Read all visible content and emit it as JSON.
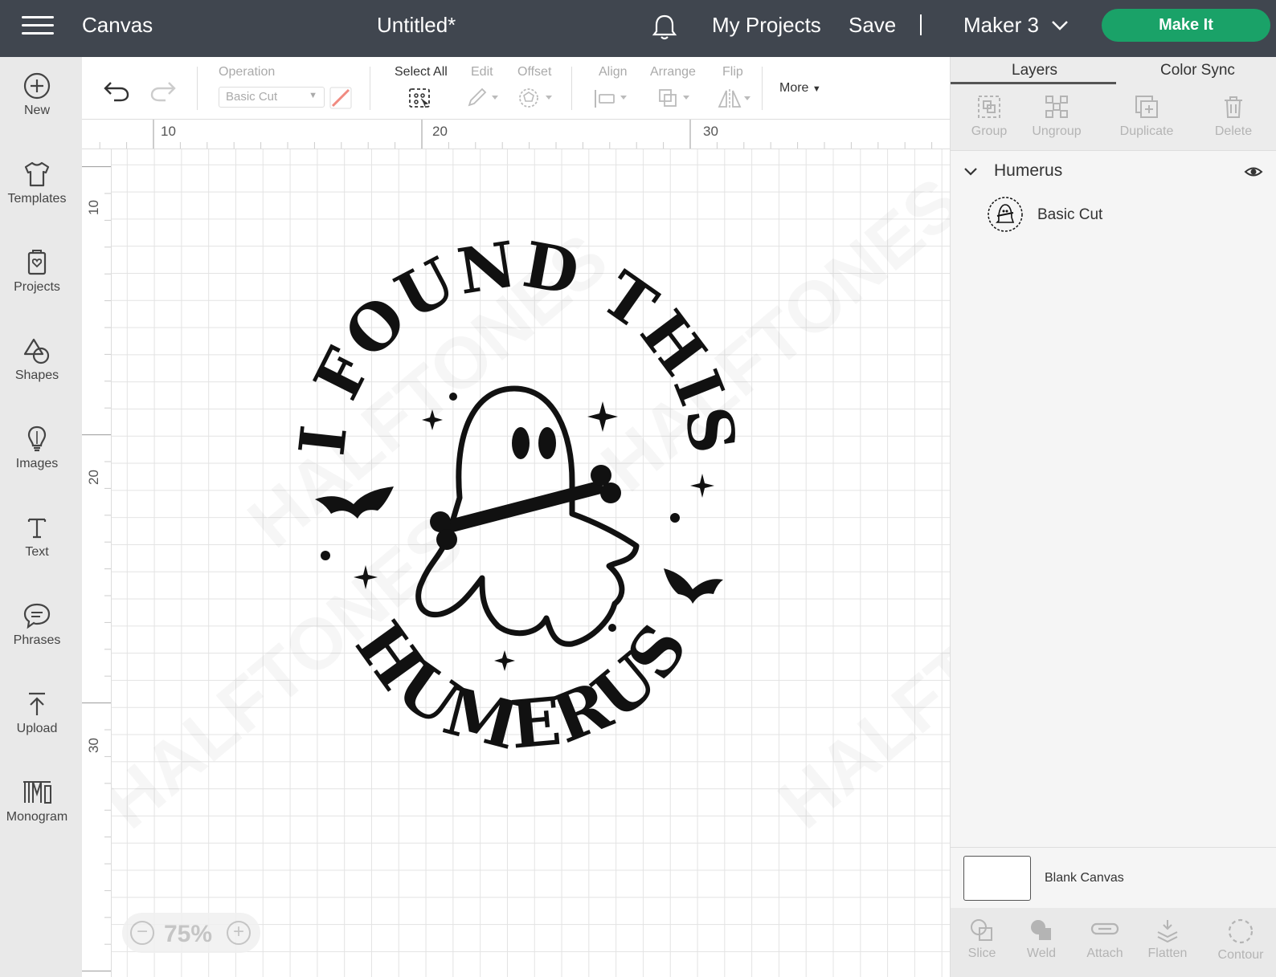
{
  "topbar": {
    "app_title": "Canvas",
    "doc_title": "Untitled*",
    "my_projects": "My Projects",
    "save": "Save",
    "machine": "Maker 3",
    "make_it": "Make It"
  },
  "sidebar": {
    "items": [
      {
        "label": "New",
        "icon": "plus-circle-icon"
      },
      {
        "label": "Templates",
        "icon": "shirt-icon"
      },
      {
        "label": "Projects",
        "icon": "projects-icon"
      },
      {
        "label": "Shapes",
        "icon": "shapes-icon"
      },
      {
        "label": "Images",
        "icon": "lightbulb-icon"
      },
      {
        "label": "Text",
        "icon": "text-icon"
      },
      {
        "label": "Phrases",
        "icon": "speech-bubble-icon"
      },
      {
        "label": "Upload",
        "icon": "upload-icon"
      },
      {
        "label": "Monogram",
        "icon": "monogram-icon"
      }
    ]
  },
  "toolbar": {
    "operation_label": "Operation",
    "operation_value": "Basic Cut",
    "select_all": "Select All",
    "edit": "Edit",
    "offset": "Offset",
    "align": "Align",
    "arrange": "Arrange",
    "flip": "Flip",
    "more": "More"
  },
  "rulers": {
    "top": [
      "10",
      "20",
      "30"
    ],
    "left": [
      "10",
      "20",
      "30"
    ]
  },
  "design": {
    "top_text": "I FOUND THIS",
    "bottom_text": "HUMERUS"
  },
  "zoom": {
    "value": "75%"
  },
  "panel": {
    "tabs": [
      "Layers",
      "Color Sync"
    ],
    "actions": [
      "Group",
      "Ungroup",
      "Duplicate",
      "Delete"
    ],
    "group_name": "Humerus",
    "layer_name": "Basic Cut",
    "blank_canvas": "Blank Canvas",
    "bottom_actions": [
      "Slice",
      "Weld",
      "Attach",
      "Flatten",
      "Contour"
    ]
  },
  "colors": {
    "topbar": "#40464f",
    "make_it": "#1aa268"
  }
}
